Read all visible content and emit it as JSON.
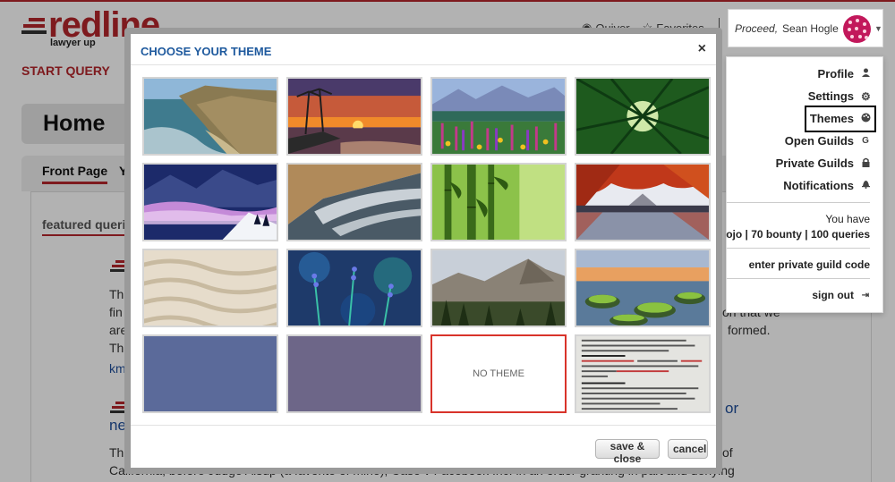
{
  "brand": {
    "name": "redline",
    "tagline": "lawyer up"
  },
  "nav": {
    "start_query": "START QUERY",
    "quiver": "Quiver",
    "favorites": "Favorites"
  },
  "user": {
    "greeting": "Proceed,",
    "name": "Sean Hogle"
  },
  "dropdown": {
    "items": [
      {
        "label": "Profile",
        "icon": "person-icon"
      },
      {
        "label": "Settings",
        "icon": "gear-icon"
      },
      {
        "label": "Themes",
        "icon": "palette-icon"
      },
      {
        "label": "Open Guilds",
        "icon": "g-icon"
      },
      {
        "label": "Private Guilds",
        "icon": "lock-icon"
      },
      {
        "label": "Notifications",
        "icon": "bell-icon"
      }
    ],
    "you_have": "You have",
    "stats_prefix": "ojo | ",
    "bounty": "70 bounty",
    "stats_sep": " | ",
    "queries": "100 queries",
    "private_code": "enter private guild code",
    "sign_out": "sign out"
  },
  "page": {
    "title": "Home",
    "tab_front": "Front Page",
    "tab_second": "Y",
    "featured": "featured queri",
    "fragments": {
      "l1": "Th",
      "l2": "fin",
      "l3": "are",
      "l4": "Th",
      "l5": "km",
      "r1": "on that we",
      "r2": "formed.",
      "big_left": "ne",
      "big_right": "or",
      "b1": "Th",
      "b1r": "of",
      "b2": "California, before Judge Alsup (a favorite of mine), Case v Facebook Inc. in an order granting in part and denying"
    }
  },
  "modal": {
    "title": "CHOOSE YOUR THEME",
    "close": "×",
    "no_theme": "NO THEME",
    "save": "save & close",
    "cancel": "cancel"
  },
  "themes": [
    "coastal-cliffs",
    "palm-sunset",
    "flower-meadow",
    "bamboo-canopy",
    "snowy-mountain-fog",
    "sandy-beach-waves",
    "bamboo-stalks",
    "autumn-lake",
    "sand-ripples",
    "lavender-bokeh",
    "granite-valley",
    "mossy-shore",
    "slate-blue",
    "slate-purple",
    "no-theme",
    "constitution-text"
  ],
  "colors": {
    "brand_red": "#b5262b",
    "title_blue": "#1f5a9e",
    "selected_border": "#d8332a",
    "swatch_blue": "#5b6a9a",
    "swatch_purple": "#6d6688"
  }
}
